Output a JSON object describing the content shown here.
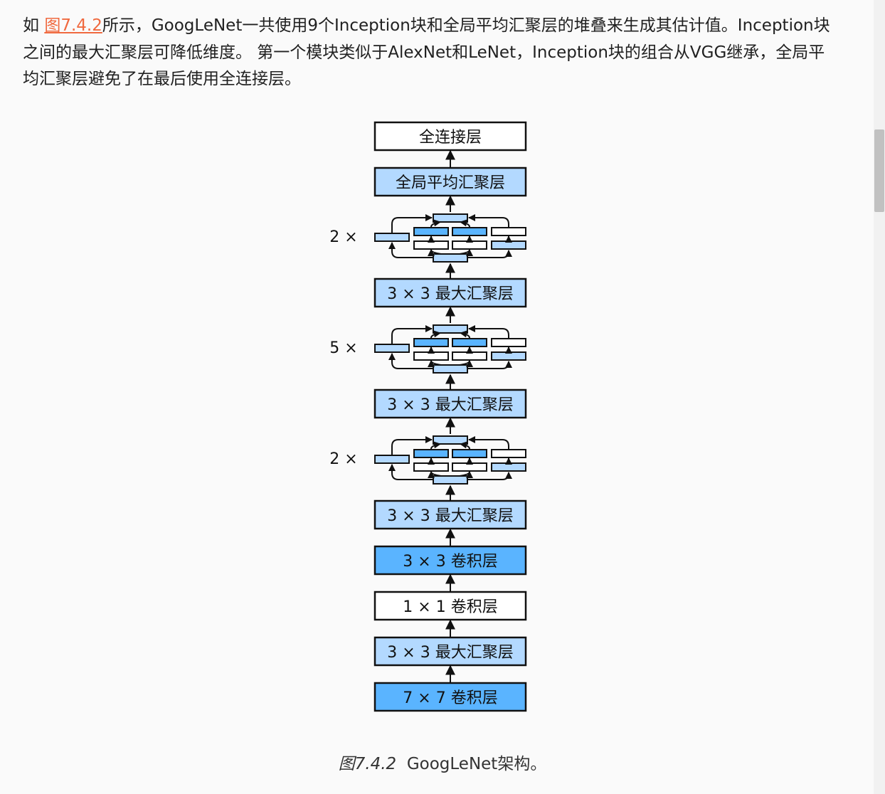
{
  "paragraph": {
    "prefix": "如 ",
    "link": "图7.4.2",
    "body": "所示，GoogLeNet一共使用9个Inception块和全局平均汇聚层的堆叠来生成其估计值。Inception块之间的最大汇聚层可降低维度。 第一个模块类似于AlexNet和LeNet，Inception块的组合从VGG继承，全局平均汇聚层避免了在最后使用全连接层。"
  },
  "figure": {
    "layers": [
      {
        "label": "全连接层",
        "style": "white"
      },
      {
        "label": "全局平均汇聚层",
        "style": "light"
      },
      {
        "label": "2 ×",
        "style": "inception"
      },
      {
        "label": "3 × 3 最大汇聚层",
        "style": "light"
      },
      {
        "label": "5 ×",
        "style": "inception"
      },
      {
        "label": "3 × 3 最大汇聚层",
        "style": "light"
      },
      {
        "label": "2 ×",
        "style": "inception"
      },
      {
        "label": "3 × 3 最大汇聚层",
        "style": "light"
      },
      {
        "label": "3 × 3 卷积层",
        "style": "dark"
      },
      {
        "label": "1 × 1 卷积层",
        "style": "white"
      },
      {
        "label": "3 × 3 最大汇聚层",
        "style": "light"
      },
      {
        "label": "7 × 7 卷积层",
        "style": "dark"
      }
    ],
    "colors": {
      "white": "#ffffff",
      "light": "#b3d9ff",
      "dark": "#5ab4ff",
      "stroke": "#111111"
    }
  },
  "caption": {
    "number": "图7.4.2",
    "text": "GoogLeNet架构。"
  }
}
